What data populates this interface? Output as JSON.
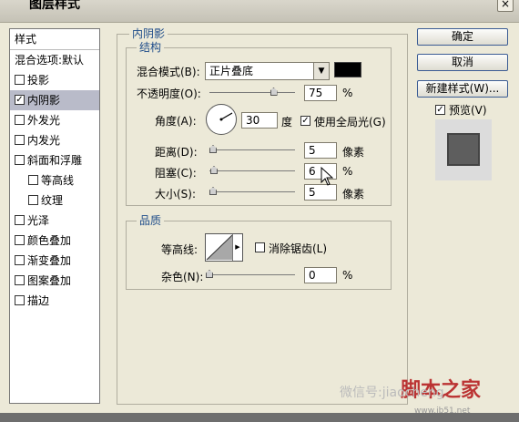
{
  "window": {
    "title": "图层样式",
    "close": "×"
  },
  "style_list": {
    "header": "样式",
    "items": [
      {
        "label": "混合选项:默认",
        "checkbox": false,
        "sub": false,
        "selected": false
      },
      {
        "label": "投影",
        "checkbox": true,
        "checked": false,
        "sub": false,
        "selected": false
      },
      {
        "label": "内阴影",
        "checkbox": true,
        "checked": true,
        "sub": false,
        "selected": true
      },
      {
        "label": "外发光",
        "checkbox": true,
        "checked": false,
        "sub": false,
        "selected": false
      },
      {
        "label": "内发光",
        "checkbox": true,
        "checked": false,
        "sub": false,
        "selected": false
      },
      {
        "label": "斜面和浮雕",
        "checkbox": true,
        "checked": false,
        "sub": false,
        "selected": false
      },
      {
        "label": "等高线",
        "checkbox": true,
        "checked": false,
        "sub": true,
        "selected": false
      },
      {
        "label": "纹理",
        "checkbox": true,
        "checked": false,
        "sub": true,
        "selected": false
      },
      {
        "label": "光泽",
        "checkbox": true,
        "checked": false,
        "sub": false,
        "selected": false
      },
      {
        "label": "颜色叠加",
        "checkbox": true,
        "checked": false,
        "sub": false,
        "selected": false
      },
      {
        "label": "渐变叠加",
        "checkbox": true,
        "checked": false,
        "sub": false,
        "selected": false
      },
      {
        "label": "图案叠加",
        "checkbox": true,
        "checked": false,
        "sub": false,
        "selected": false
      },
      {
        "label": "描边",
        "checkbox": true,
        "checked": false,
        "sub": false,
        "selected": false
      }
    ]
  },
  "inner_shadow": {
    "group_title": "内阴影",
    "structure_title": "结构",
    "blend_mode_label": "混合模式(B):",
    "blend_mode_value": "正片叠底",
    "shadow_color": "#000000",
    "opacity_label": "不透明度(O):",
    "opacity_value": "75",
    "opacity_unit": "%",
    "opacity_level": 0.75,
    "angle_label": "角度(A):",
    "angle_value": "30",
    "angle_unit": "度",
    "global_light_label": "使用全局光(G)",
    "global_light_checked": true,
    "distance_label": "距离(D):",
    "distance_value": "5",
    "distance_unit": "像素",
    "choke_label": "阻塞(C):",
    "choke_value": "6",
    "choke_unit": "%",
    "size_label": "大小(S):",
    "size_value": "5",
    "size_unit": "像素"
  },
  "quality": {
    "group_title": "品质",
    "contour_label": "等高线:",
    "antialias_label": "消除锯齿(L)",
    "antialias_checked": false,
    "noise_label": "杂色(N):",
    "noise_value": "0",
    "noise_unit": "%"
  },
  "buttons": {
    "ok": "确定",
    "cancel": "取消",
    "new_style": "新建样式(W)...",
    "preview_label": "预览(V)",
    "preview_checked": true
  },
  "watermark": {
    "text": "微信号:jiaocheng",
    "logo": "脚本之家",
    "url": "www.jb51.net"
  }
}
